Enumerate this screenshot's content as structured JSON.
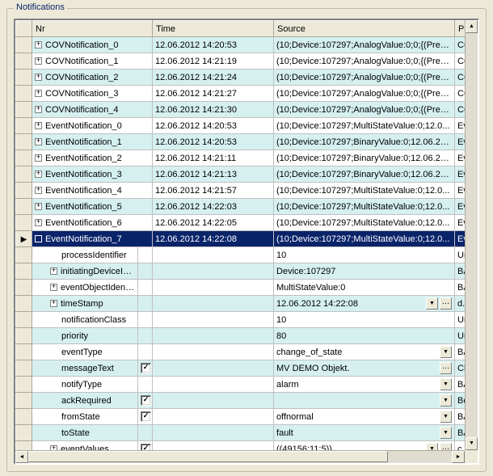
{
  "groupbox_title": "Notifications",
  "columns": {
    "nr": "Nr",
    "time": "Time",
    "source": "Source",
    "param": "Param"
  },
  "rows": [
    {
      "kind": "top",
      "exp": "plus",
      "nr": "COVNotification_0",
      "time": "12.06.2012 14:20:53",
      "src": "(10;Device:107297;AnalogValue:0;0;{(Pres...",
      "param": "COV..."
    },
    {
      "kind": "top",
      "exp": "plus",
      "nr": "COVNotification_1",
      "time": "12.06.2012 14:21:19",
      "src": "(10;Device:107297;AnalogValue:0;0;{(Pres...",
      "param": "COV..."
    },
    {
      "kind": "top",
      "exp": "plus",
      "nr": "COVNotification_2",
      "time": "12.06.2012 14:21:24",
      "src": "(10;Device:107297;AnalogValue:0;0;{(Pres...",
      "param": "COV..."
    },
    {
      "kind": "top",
      "exp": "plus",
      "nr": "COVNotification_3",
      "time": "12.06.2012 14:21:27",
      "src": "(10;Device:107297;AnalogValue:0;0;{(Pres...",
      "param": "COV..."
    },
    {
      "kind": "top",
      "exp": "plus",
      "nr": "COVNotification_4",
      "time": "12.06.2012 14:21:30",
      "src": "(10;Device:107297;AnalogValue:0;0;{(Pres...",
      "param": "COV..."
    },
    {
      "kind": "top",
      "exp": "plus",
      "nr": "EventNotification_0",
      "time": "12.06.2012 14:20:53",
      "src": "(10;Device:107297;MultiStateValue:0;12.0...",
      "param": "Eve..."
    },
    {
      "kind": "top",
      "exp": "plus",
      "nr": "EventNotification_1",
      "time": "12.06.2012 14:20:53",
      "src": "(10;Device:107297;BinaryValue:0;12.06.20...",
      "param": "Eve..."
    },
    {
      "kind": "top",
      "exp": "plus",
      "nr": "EventNotification_2",
      "time": "12.06.2012 14:21:11",
      "src": "(10;Device:107297;BinaryValue:0;12.06.20...",
      "param": "Eve..."
    },
    {
      "kind": "top",
      "exp": "plus",
      "nr": "EventNotification_3",
      "time": "12.06.2012 14:21:13",
      "src": "(10;Device:107297;BinaryValue:0;12.06.20...",
      "param": "Eve..."
    },
    {
      "kind": "top",
      "exp": "plus",
      "nr": "EventNotification_4",
      "time": "12.06.2012 14:21:57",
      "src": "(10;Device:107297;MultiStateValue:0;12.0...",
      "param": "Eve..."
    },
    {
      "kind": "top",
      "exp": "plus",
      "nr": "EventNotification_5",
      "time": "12.06.2012 14:22:03",
      "src": "(10;Device:107297;MultiStateValue:0;12.0...",
      "param": "Eve..."
    },
    {
      "kind": "top",
      "exp": "plus",
      "nr": "EventNotification_6",
      "time": "12.06.2012 14:22:05",
      "src": "(10;Device:107297;MultiStateValue:0;12.0...",
      "param": "Eve..."
    },
    {
      "kind": "sel",
      "exp": "minus",
      "nr": "EventNotification_7",
      "time": "12.06.2012 14:22:08",
      "src": "(10;Device:107297;MultiStateValue:0;12.0...",
      "param": "Eve..."
    },
    {
      "kind": "sub",
      "indent": 2,
      "label": "processIdentifier",
      "check": null,
      "val": "10",
      "combo": false,
      "ell": false,
      "param": "Unsi..."
    },
    {
      "kind": "sub",
      "indent": 1,
      "exp": "plus",
      "label": "initiatingDeviceId…",
      "check": null,
      "val": "Device:107297",
      "combo": false,
      "ell": false,
      "param": "BAC..."
    },
    {
      "kind": "sub",
      "indent": 1,
      "exp": "plus",
      "label": "eventObjectIdent…",
      "check": null,
      "val": "MultiStateValue:0",
      "combo": false,
      "ell": false,
      "param": "BAC..."
    },
    {
      "kind": "sub",
      "indent": 1,
      "exp": "plus",
      "label": "timeStamp",
      "check": null,
      "val": "12.06.2012 14:22:08",
      "combo": true,
      "ell": true,
      "param": "d..."
    },
    {
      "kind": "sub",
      "indent": 2,
      "label": "notificationClass",
      "check": null,
      "val": "10",
      "combo": false,
      "ell": false,
      "param": "Unsi..."
    },
    {
      "kind": "sub",
      "indent": 2,
      "label": "priority",
      "check": null,
      "val": "80",
      "combo": false,
      "ell": false,
      "param": "Unsi..."
    },
    {
      "kind": "sub",
      "indent": 2,
      "label": "eventType",
      "check": null,
      "val": "change_of_state",
      "combo": true,
      "ell": false,
      "param": "BAC..."
    },
    {
      "kind": "sub",
      "indent": 2,
      "label": "messageText",
      "check": true,
      "val": "MV DEMO Objekt.",
      "combo": false,
      "ell": true,
      "param": "Char..."
    },
    {
      "kind": "sub",
      "indent": 2,
      "label": "notifyType",
      "check": null,
      "val": "alarm",
      "combo": true,
      "ell": false,
      "param": "BAC..."
    },
    {
      "kind": "sub",
      "indent": 2,
      "label": "ackRequired",
      "check": true,
      "val": "",
      "combo": true,
      "ell": false,
      "param": "Bool"
    },
    {
      "kind": "sub",
      "indent": 2,
      "label": "fromState",
      "check": true,
      "val": "offnormal",
      "combo": true,
      "ell": false,
      "param": "BAC..."
    },
    {
      "kind": "sub",
      "indent": 2,
      "label": "toState",
      "check": null,
      "val": "fault",
      "combo": true,
      "ell": false,
      "param": "BAC..."
    },
    {
      "kind": "sub",
      "indent": 1,
      "exp": "plus",
      "label": "eventValues",
      "check": true,
      "val": "((49156;11;5))",
      "combo": true,
      "ell": true,
      "param": "c..."
    }
  ]
}
